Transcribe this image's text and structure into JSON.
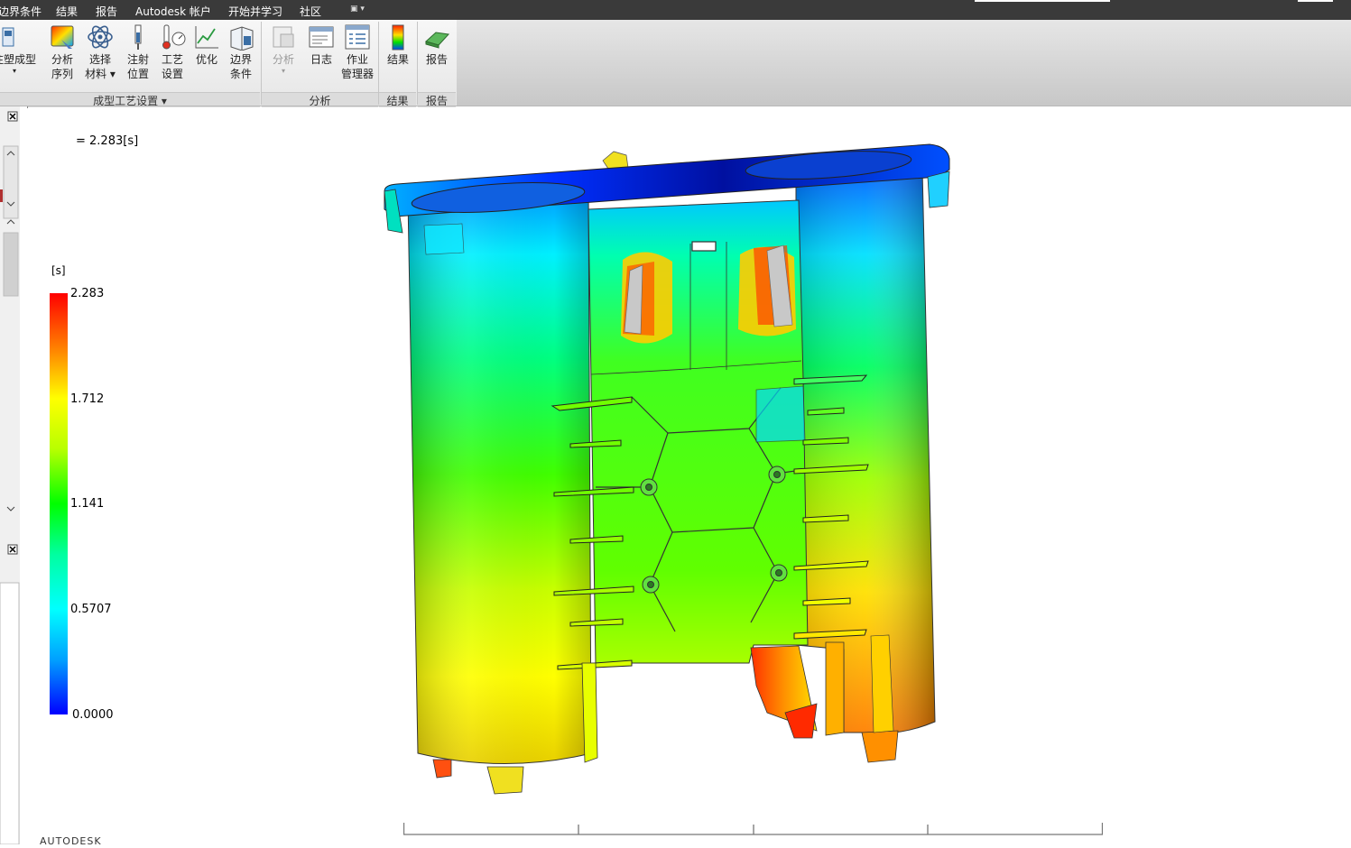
{
  "menubar": {
    "items": [
      "边界条件",
      "结果",
      "报告",
      "Autodesk 帐户",
      "开始并学习",
      "社区"
    ]
  },
  "ribbon": {
    "groups": [
      {
        "title": "成型工艺设置 ▾",
        "buttons": [
          {
            "label1": "注塑成型",
            "label2": "▾",
            "icon": "mold-icon"
          },
          {
            "label1": "分析",
            "label2": "序列",
            "icon": "analysis-sequence-icon"
          },
          {
            "label1": "选择",
            "label2": "材料 ▾",
            "icon": "select-material-icon"
          },
          {
            "label1": "注射",
            "label2": "位置",
            "icon": "injection-location-icon"
          },
          {
            "label1": "工艺",
            "label2": "设置",
            "icon": "process-settings-icon"
          },
          {
            "label1": "优化",
            "label2": "",
            "icon": "optimize-icon"
          },
          {
            "label1": "边界",
            "label2": "条件",
            "icon": "boundary-conditions-icon"
          }
        ]
      },
      {
        "title": "分析",
        "buttons": [
          {
            "label1": "分析",
            "label2": "▾",
            "icon": "analyze-icon",
            "disabled": true
          },
          {
            "label1": "日志",
            "label2": "",
            "icon": "log-icon"
          },
          {
            "label1": "作业",
            "label2": "管理器",
            "icon": "job-manager-icon"
          }
        ]
      },
      {
        "title": "结果",
        "buttons": [
          {
            "label1": "结果",
            "label2": "",
            "icon": "results-icon"
          }
        ]
      },
      {
        "title": "报告",
        "buttons": [
          {
            "label1": "报告",
            "label2": "",
            "icon": "report-icon"
          }
        ]
      }
    ]
  },
  "viewport": {
    "time_label": "= 2.283[s]",
    "unit": "[s]",
    "legend": [
      "2.283",
      "1.712",
      "1.141",
      "0.5707",
      "0.0000"
    ],
    "brand": "AUTODESK"
  },
  "colors": {
    "menubar": "#3a3a3a",
    "accent": "#0078d7"
  }
}
